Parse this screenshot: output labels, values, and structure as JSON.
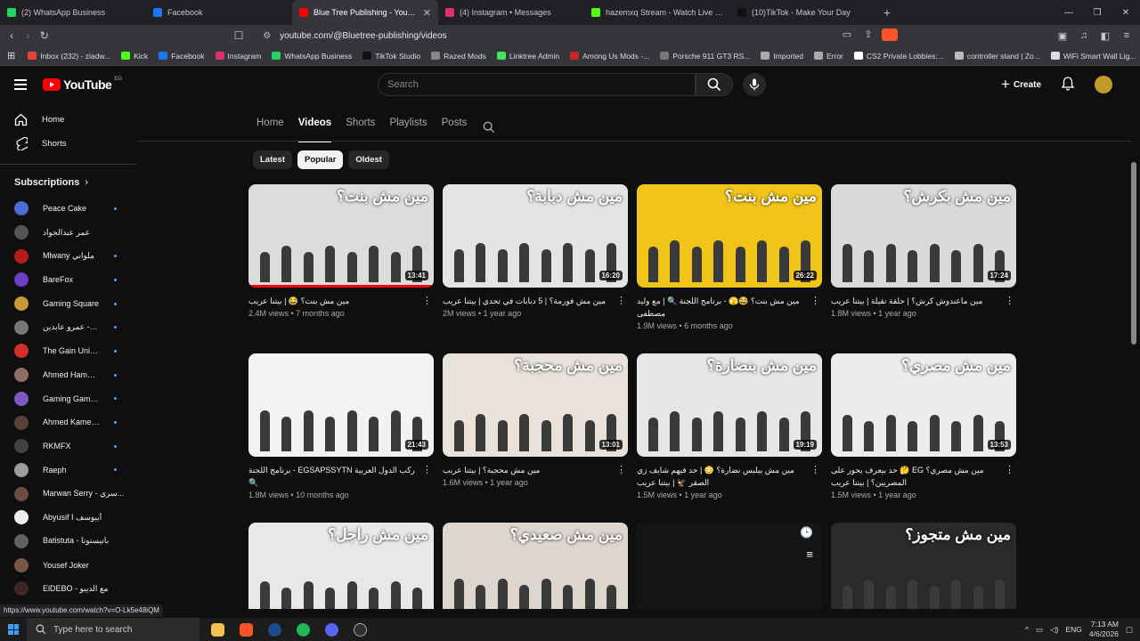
{
  "tabs": [
    {
      "label": "(2) WhatsApp Business",
      "color": "#25d366",
      "active": false
    },
    {
      "label": "Facebook",
      "color": "#1877f2",
      "active": false
    },
    {
      "label": "Blue Tree Publishing - YouTube",
      "color": "#ff0000",
      "active": true
    },
    {
      "label": "(4) Instagram • Messages",
      "color": "#e1306c",
      "active": false
    },
    {
      "label": "hazemxq Stream - Watch Live on Kick",
      "color": "#53fc18",
      "active": false
    },
    {
      "label": "(10)TikTok - Make Your Day",
      "color": "#111111",
      "active": false
    }
  ],
  "address": {
    "url": "youtube.com/@Bluetree-publishing/videos"
  },
  "bookmarks": [
    {
      "label": "Inbox (232) - ziadw...",
      "color": "#ea4335"
    },
    {
      "label": "Kick",
      "color": "#53fc18"
    },
    {
      "label": "Facebook",
      "color": "#1877f2"
    },
    {
      "label": "Instagram",
      "color": "#e1306c"
    },
    {
      "label": "WhatsApp Business",
      "color": "#25d366"
    },
    {
      "label": "TikTok Studio",
      "color": "#111111"
    },
    {
      "label": "Razed Mods",
      "color": "#888888"
    },
    {
      "label": "Linktree Admin",
      "color": "#43e660"
    },
    {
      "label": "Among Us Mods -...",
      "color": "#c62828"
    },
    {
      "label": "Porsche 911 GT3 RS...",
      "color": "#777777"
    },
    {
      "label": "Imported",
      "color": "#aaaaaa"
    },
    {
      "label": "Error",
      "color": "#aaaaaa"
    },
    {
      "label": "CS2 Private Lobbies:...",
      "color": "#ffffff"
    },
    {
      "label": "controller stand | Zo...",
      "color": "#bbbbbb"
    },
    {
      "label": "WiFi Smart Wall Lig...",
      "color": "#dddddd"
    }
  ],
  "header": {
    "logo_text": "YouTube",
    "region": "EG",
    "search_placeholder": "Search",
    "create_label": "Create"
  },
  "sidebar": {
    "nav": [
      {
        "label": "Home"
      },
      {
        "label": "Shorts"
      }
    ],
    "subscriptions_title": "Subscriptions",
    "subscriptions": [
      {
        "name": "Peace Cake",
        "color": "#4a6cd4",
        "dot": true
      },
      {
        "name": "عمر عبدالجواد",
        "color": "#555555",
        "dot": false
      },
      {
        "name": "Mlwany ملواني",
        "color": "#b71c1c",
        "dot": true
      },
      {
        "name": "BareFox",
        "color": "#6a3fc8",
        "dot": true
      },
      {
        "name": "Gaming Square",
        "color": "#c69a3a",
        "dot": true
      },
      {
        "name": "حكاوي - عمرو عابدين",
        "color": "#777777",
        "dot": true
      },
      {
        "name": "The Gain Universe",
        "color": "#d32f2f",
        "dot": true
      },
      {
        "name": "Ahmed Hamdy - ...",
        "color": "#8d6e63",
        "dot": true
      },
      {
        "name": "Gaming Gambler",
        "color": "#7e57c2",
        "dot": true
      },
      {
        "name": "Ahmed Kamel - ل...",
        "color": "#5d4037",
        "dot": true
      },
      {
        "name": "RKMFX",
        "color": "#424242",
        "dot": true
      },
      {
        "name": "Raeph",
        "color": "#9e9e9e",
        "dot": true
      },
      {
        "name": "Marwan Serry - سري...",
        "color": "#6d4c41",
        "dot": false
      },
      {
        "name": "Abyusif I أبيوسف",
        "color": "#eeeeee",
        "dot": false
      },
      {
        "name": "Batistuta - باتيستوتا",
        "color": "#616161",
        "dot": false
      },
      {
        "name": "Yousef Joker",
        "color": "#795548",
        "dot": false
      },
      {
        "name": "ElDEBO - مع الديبو",
        "color": "#3e2723",
        "dot": false
      }
    ]
  },
  "channel_tabs": [
    {
      "label": "Home",
      "active": false
    },
    {
      "label": "Videos",
      "active": true
    },
    {
      "label": "Shorts",
      "active": false
    },
    {
      "label": "Playlists",
      "active": false
    },
    {
      "label": "Posts",
      "active": false
    }
  ],
  "chips": [
    {
      "label": "Latest",
      "active": false
    },
    {
      "label": "Popular",
      "active": true
    },
    {
      "label": "Oldest",
      "active": false
    }
  ],
  "videos": [
    {
      "thumb_text": "مين مش بنت؟",
      "bg": "#dcdcdc",
      "duration": "13:41",
      "title": "مين مش بنت؟ 😂 | بيتنا عريب",
      "views": "2.4M views",
      "age": "7 months ago",
      "progress": 1.0
    },
    {
      "thumb_text": "مين مش دبابة؟",
      "bg": "#e4e4e4",
      "duration": "16:20",
      "title": "مين مش فورمة؟ | 5 دبابات في تحدي | بيتنا عريب",
      "views": "2M views",
      "age": "1 year ago",
      "progress": 0
    },
    {
      "thumb_text": "مين مش بنت؟",
      "bg": "#f0c419",
      "duration": "26:22",
      "title": "مين مش بنت؟ 😂🫣 - برنامج اللجنة 🔍 | مع وليد مصطفى",
      "views": "1.9M views",
      "age": "6 months ago",
      "progress": 0
    },
    {
      "thumb_text": "مين مش بكرش؟",
      "bg": "#dadada",
      "duration": "17:24",
      "title": "مين ماعندوش كرش؟ | حلقة تقيلة | بيتنا عريب",
      "views": "1.8M views",
      "age": "1 year ago",
      "progress": 0
    },
    {
      "thumb_text": "",
      "bg": "#f2f2f2",
      "duration": "21:43",
      "title": "ركب الدول العربية EGSAPSSYTN - برنامج اللجنة 🔍",
      "views": "1.8M views",
      "age": "10 months ago",
      "progress": 0
    },
    {
      "thumb_text": "مين مش محجبة؟",
      "bg": "#e8e2da",
      "duration": "13:01",
      "title": "مين مش محجبة؟ | بيتنا عريب",
      "views": "1.6M views",
      "age": "1 year ago",
      "progress": 0
    },
    {
      "thumb_text": "مين مش بنضارة؟",
      "bg": "#e6e6e6",
      "duration": "19:19",
      "title": "مين مش بيلبس نضارة؟ 😳 | حد فيهم شايف زي الصقر 🦅 | بيتنا عريب",
      "views": "1.5M views",
      "age": "1 year ago",
      "progress": 0
    },
    {
      "thumb_text": "مين مش مصري؟",
      "bg": "#ececec",
      "duration": "13:53",
      "title": "مين مش مصري؟ EG 🤔 حد بيعرف يحور على المصريين؟ | بيتنا عريب",
      "views": "1.5M views",
      "age": "1 year ago",
      "progress": 0
    },
    {
      "thumb_text": "مين مش راجل؟",
      "bg": "#e8e8e8",
      "duration": "9:43",
      "title": "",
      "views": "",
      "age": "",
      "progress": 0
    },
    {
      "thumb_text": "مين مش صعيدي؟",
      "bg": "#dcd6cc",
      "duration": "17:00",
      "title": "",
      "views": "",
      "age": "",
      "progress": 0
    },
    {
      "thumb_text": "",
      "bg": "#151515",
      "duration": "",
      "title": "",
      "views": "",
      "age": "",
      "progress": 0
    },
    {
      "thumb_text": "مين مش متجوز؟",
      "bg": "#2a2a2a",
      "duration": "18:10",
      "title": "",
      "views": "",
      "age": "",
      "progress": 0
    }
  ],
  "statusbar": {
    "url": "https://www.youtube.com/watch?v=O-Lk5e48iQM"
  },
  "taskbar": {
    "search_placeholder": "Type here to search",
    "lang": "ENG",
    "time": "7:13 AM",
    "date": "4/6/2026"
  }
}
